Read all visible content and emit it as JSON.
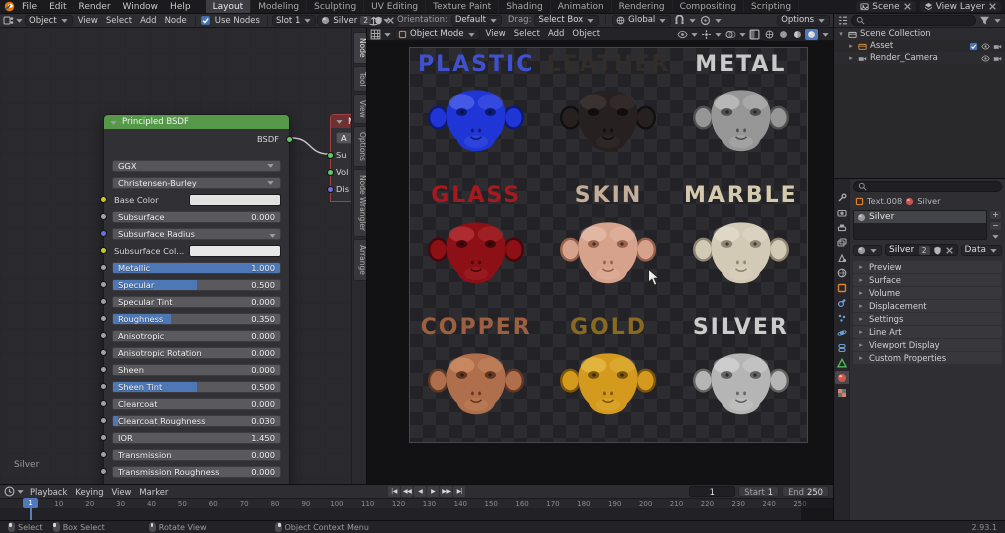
{
  "topbar": {
    "menus": [
      "File",
      "Edit",
      "Render",
      "Window",
      "Help"
    ],
    "workspaces": [
      "Layout",
      "Modeling",
      "Sculpting",
      "UV Editing",
      "Texture Paint",
      "Shading",
      "Animation",
      "Rendering",
      "Compositing",
      "Scripting"
    ],
    "active_workspace": "Layout",
    "scene_label": "Scene",
    "view_layer_label": "View Layer"
  },
  "shader_header": {
    "shader_type": "Object",
    "menus": [
      "View",
      "Select",
      "Add",
      "Node"
    ],
    "use_nodes_label": "Use Nodes",
    "slot_label": "Slot 1",
    "material_name": "Silver",
    "material_users": "2"
  },
  "tool_settings": {
    "orientation_label": "Orientation:",
    "orientation_value": "Default",
    "drag_label": "Drag:",
    "drag_value": "Select Box",
    "transform_space": "Global",
    "options_label": "Options"
  },
  "shader_editor": {
    "sidebar_tabs": [
      "Node",
      "Tool",
      "View",
      "Options",
      "Node Wrangler",
      "Arrange"
    ],
    "footer_label": "Silver",
    "node": {
      "title": "Principled BSDF",
      "output": {
        "label": "BSDF",
        "socket": "#63c763"
      },
      "dropdowns": [
        "GGX",
        "Christensen-Burley"
      ],
      "params": [
        {
          "label": "Base Color",
          "type": "color",
          "swatch": "#e2e2e2",
          "socket": "#c7c729"
        },
        {
          "label": "Subsurface",
          "type": "slider",
          "value": "0.000",
          "fill": 0,
          "socket": "#a1a1a1"
        },
        {
          "label": "Subsurface Radius",
          "type": "vector",
          "socket": "#6e6ee0"
        },
        {
          "label": "Subsurface Col...",
          "type": "color",
          "swatch": "#e8e8e8",
          "socket": "#c7c729"
        },
        {
          "label": "Metallic",
          "type": "slider",
          "value": "1.000",
          "fill": 1,
          "socket": "#a1a1a1"
        },
        {
          "label": "Specular",
          "type": "slider",
          "value": "0.500",
          "fill": 0.5,
          "socket": "#a1a1a1"
        },
        {
          "label": "Specular Tint",
          "type": "slider",
          "value": "0.000",
          "fill": 0,
          "socket": "#a1a1a1"
        },
        {
          "label": "Roughness",
          "type": "slider",
          "value": "0.350",
          "fill": 0.35,
          "socket": "#a1a1a1"
        },
        {
          "label": "Anisotropic",
          "type": "slider",
          "value": "0.000",
          "fill": 0,
          "socket": "#a1a1a1"
        },
        {
          "label": "Anisotropic Rotation",
          "type": "slider",
          "value": "0.000",
          "fill": 0,
          "socket": "#a1a1a1"
        },
        {
          "label": "Sheen",
          "type": "slider",
          "value": "0.000",
          "fill": 0,
          "socket": "#a1a1a1"
        },
        {
          "label": "Sheen Tint",
          "type": "slider",
          "value": "0.500",
          "fill": 0.5,
          "socket": "#a1a1a1"
        },
        {
          "label": "Clearcoat",
          "type": "slider",
          "value": "0.000",
          "fill": 0,
          "socket": "#a1a1a1"
        },
        {
          "label": "Clearcoat Roughness",
          "type": "slider",
          "value": "0.030",
          "fill": 0.03,
          "socket": "#a1a1a1"
        },
        {
          "label": "IOR",
          "type": "number",
          "value": "1.450",
          "socket": "#a1a1a1"
        },
        {
          "label": "Transmission",
          "type": "slider",
          "value": "0.000",
          "fill": 0,
          "socket": "#a1a1a1"
        },
        {
          "label": "Transmission Roughness",
          "type": "slider",
          "value": "0.000",
          "fill": 0,
          "socket": "#a1a1a1"
        }
      ]
    },
    "output_node": {
      "title": "M",
      "dropdown": "A",
      "inputs": [
        {
          "label": "Su",
          "socket": "#63c763"
        },
        {
          "label": "Vol",
          "socket": "#63c763"
        },
        {
          "label": "Dis",
          "socket": "#7070d8"
        }
      ]
    }
  },
  "viewport": {
    "mode": "Object Mode",
    "menus": [
      "View",
      "Select",
      "Add",
      "Object"
    ],
    "monkeys": [
      {
        "label": "PLASTIC",
        "label_color": "#3f51cf",
        "body": "#1f35d6",
        "shade": "#0c1a77",
        "highlight": "#7d92ff"
      },
      {
        "label": "LEATHER",
        "label_color": "#332d29",
        "body": "#262120",
        "shade": "#110f0e",
        "highlight": "#5a4d44"
      },
      {
        "label": "METAL",
        "label_color": "#c9c9c9",
        "body": "#969696",
        "shade": "#4f4f4f",
        "highlight": "#e8e8e8"
      },
      {
        "label": "GLASS",
        "label_color": "#a41a1e",
        "body": "#8c1015",
        "shade": "#45070b",
        "highlight": "#e0555b"
      },
      {
        "label": "SKIN",
        "label_color": "#c4ae9a",
        "body": "#d6a28b",
        "shade": "#99614b",
        "highlight": "#f6d8c6"
      },
      {
        "label": "MARBLE",
        "label_color": "#d5caae",
        "body": "#d3cab6",
        "shade": "#8f8672",
        "highlight": "#f4eee2"
      },
      {
        "label": "COPPER",
        "label_color": "#9c5f40",
        "body": "#b06f4c",
        "shade": "#643722",
        "highlight": "#eaac80"
      },
      {
        "label": "GOLD",
        "label_color": "#8a6a20",
        "body": "#d49a1e",
        "shade": "#7e560a",
        "highlight": "#f8d96c"
      },
      {
        "label": "SILVER",
        "label_color": "#cccccc",
        "body": "#b5b5b5",
        "shade": "#636363",
        "highlight": "#f0f0f0"
      }
    ]
  },
  "outliner": {
    "rows": [
      {
        "label": "Scene Collection",
        "icon": "collection",
        "icon_color": "#c2c2c2",
        "depth": 0,
        "disclosure": "▾",
        "toggles": []
      },
      {
        "label": "Asset",
        "icon": "collection",
        "icon_color": "#d9913d",
        "depth": 1,
        "disclosure": "▸",
        "toggles": [
          "checkbox",
          "eye",
          "camera"
        ]
      },
      {
        "label": "Render_Camera",
        "icon": "camera",
        "icon_color": "#9a9a9a",
        "depth": 1,
        "disclosure": "▸",
        "toggles": [
          "eye",
          "camera"
        ]
      }
    ]
  },
  "properties": {
    "breadcrumb_object": "Text.008",
    "breadcrumb_material": "Silver",
    "slot_name": "Silver",
    "slot_add_glyph": "+",
    "slot_remove_glyph": "−",
    "name_value": "Silver",
    "users_count": "2",
    "link_value": "Data",
    "panel_disclosure": "▸",
    "panels": [
      "Preview",
      "Surface",
      "Volume",
      "Displacement",
      "Settings",
      "Line Art",
      "Viewport Display",
      "Custom Properties"
    ],
    "tabs": [
      {
        "name": "tool",
        "color": "#a8a8a8",
        "active": false
      },
      {
        "name": "render",
        "color": "#a8a8a8",
        "active": false
      },
      {
        "name": "output",
        "color": "#a8a8a8",
        "active": false
      },
      {
        "name": "view-layer",
        "color": "#a8a8a8",
        "active": false
      },
      {
        "name": "scene",
        "color": "#a8a8a8",
        "active": false
      },
      {
        "name": "world",
        "color": "#a8a8a8",
        "active": false
      },
      {
        "name": "object",
        "color": "#e0822d",
        "active": false
      },
      {
        "name": "modifiers",
        "color": "#6c9fd8",
        "active": false
      },
      {
        "name": "particles",
        "color": "#6c9fd8",
        "active": false
      },
      {
        "name": "physics",
        "color": "#6c9fd8",
        "active": false
      },
      {
        "name": "constraints",
        "color": "#6c9fd8",
        "active": false
      },
      {
        "name": "object-data",
        "color": "#58b858",
        "active": false
      },
      {
        "name": "material",
        "color": "#d4564f",
        "active": true
      },
      {
        "name": "texture",
        "color": "#d4836e",
        "active": false
      }
    ]
  },
  "timeline": {
    "menus": [
      "Playback",
      "Keying",
      "View",
      "Marker"
    ],
    "transport": [
      {
        "name": "jump-to-start",
        "glyph": "|◀"
      },
      {
        "name": "previous-keyframe",
        "glyph": "◀◀"
      },
      {
        "name": "play-reverse",
        "glyph": "◀"
      },
      {
        "name": "play",
        "glyph": "▶"
      },
      {
        "name": "next-keyframe",
        "glyph": "▶▶"
      },
      {
        "name": "jump-to-end",
        "glyph": "▶|"
      }
    ],
    "current_frame": "1",
    "start_label": "Start",
    "start_value": "1",
    "end_label": "End",
    "end_value": "250",
    "ticks": [
      10,
      20,
      30,
      40,
      50,
      60,
      70,
      80,
      90,
      100,
      110,
      120,
      130,
      140,
      150,
      160,
      170,
      180,
      190,
      200,
      210,
      220,
      230,
      240,
      250
    ]
  },
  "statusbar": {
    "groups": [
      {
        "gap": 0,
        "items": [
          {
            "icon": "mouse-left",
            "label": "Select"
          },
          {
            "icon": "mouse-left",
            "label": "Box Select"
          }
        ]
      },
      {
        "gap": 34,
        "items": [
          {
            "icon": "mouse-middle",
            "label": "Rotate View"
          }
        ]
      },
      {
        "gap": 58,
        "items": [
          {
            "icon": "mouse-right",
            "label": "Object Context Menu"
          }
        ]
      }
    ],
    "version": "2.93.1"
  }
}
